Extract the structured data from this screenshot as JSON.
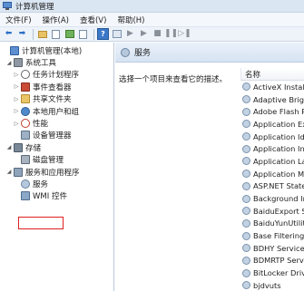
{
  "window": {
    "title": "计算机管理"
  },
  "menu": [
    "文件(F)",
    "操作(A)",
    "查看(V)",
    "帮助(H)"
  ],
  "toolbar": {
    "blue_button_label": "?"
  },
  "tree": [
    {
      "label": "计算机管理(本地)",
      "expander": "",
      "icon": "computer-icon"
    },
    {
      "label": "系统工具",
      "expander": "◢",
      "icon": "tools-icon"
    },
    {
      "label": "任务计划程序",
      "expander": "▷",
      "icon": "clock-icon"
    },
    {
      "label": "事件查看器",
      "expander": "▷",
      "icon": "event-viewer-icon"
    },
    {
      "label": "共享文件夹",
      "expander": "▷",
      "icon": "shared-folder-icon"
    },
    {
      "label": "本地用户和组",
      "expander": "▷",
      "icon": "users-icon"
    },
    {
      "label": "性能",
      "expander": "▷",
      "icon": "performance-icon"
    },
    {
      "label": "设备管理器",
      "expander": "",
      "icon": "device-manager-icon"
    },
    {
      "label": "存储",
      "expander": "◢",
      "icon": "storage-icon"
    },
    {
      "label": "磁盘管理",
      "expander": "",
      "icon": "disk-icon"
    },
    {
      "label": "服务和应用程序",
      "expander": "◢",
      "icon": "services-apps-icon"
    },
    {
      "label": "服务",
      "expander": "",
      "icon": "gear-icon"
    },
    {
      "label": "WMI 控件",
      "expander": "",
      "icon": "wmi-icon"
    }
  ],
  "content": {
    "header": "服务",
    "description": "选择一个项目来查看它的描述。",
    "column_name": "名称",
    "services": [
      "ActiveX Installe",
      "Adaptive Brigh",
      "Adobe Flash Pl",
      "Application Exp",
      "Application Ide",
      "Application Info",
      "Application Lay",
      "Application Ma",
      "ASP.NET State",
      "Background In",
      "BaiduExport Se",
      "BaiduYunUtility",
      "Base Filtering E",
      "BDHY Service",
      "BDMRTP Servic",
      "BitLocker Drive",
      "bjdvuts"
    ]
  }
}
